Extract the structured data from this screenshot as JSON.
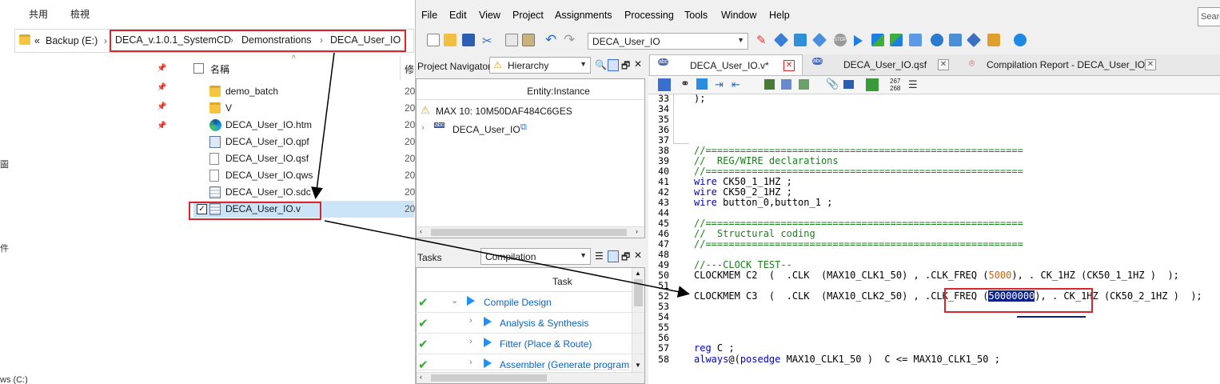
{
  "explorer": {
    "ribbon_tabs": [
      "共用",
      "檢視"
    ],
    "address": {
      "back_chevron": "«",
      "segments": [
        "Backup (E:)",
        "DECA_v.1.0.1_SystemCD",
        "Demonstrations",
        "DECA_User_IO"
      ]
    },
    "left_pane": {
      "partial_chars": [
        "圖",
        "件"
      ],
      "drive_partial": "ws (C:)"
    },
    "columns": {
      "name": "名稱",
      "modified_partial": "修"
    },
    "files": [
      {
        "name": "demo_batch",
        "type": "folder",
        "col2": "20"
      },
      {
        "name": "V",
        "type": "folder",
        "col2": "20"
      },
      {
        "name": "DECA_User_IO.htm",
        "type": "edge",
        "col2": "20"
      },
      {
        "name": "DECA_User_IO.qpf",
        "type": "qpf",
        "col2": "20"
      },
      {
        "name": "DECA_User_IO.qsf",
        "type": "doc",
        "col2": "20"
      },
      {
        "name": "DECA_User_IO.qws",
        "type": "doc",
        "col2": "20"
      },
      {
        "name": "DECA_User_IO.sdc",
        "type": "sdc",
        "col2": "20"
      },
      {
        "name": "DECA_User_IO.v",
        "type": "v",
        "col2": "20",
        "selected": true
      }
    ]
  },
  "quartus": {
    "menu": [
      "File",
      "Edit",
      "View",
      "Project",
      "Assignments",
      "Processing",
      "Tools",
      "Window",
      "Help"
    ],
    "search_placeholder": "Searc",
    "toolbar_combo": "DECA_User_IO",
    "project_navigator": {
      "title": "Project Navigator",
      "mode": "Hierarchy",
      "column": "Entity:Instance",
      "device": "MAX 10: 10M50DAF484C6GES",
      "top_entity": "DECA_User_IO",
      "abc_badge": "abc"
    },
    "tasks": {
      "title": "Tasks",
      "mode": "Compilation",
      "column": "Task",
      "items": [
        {
          "label": "Compile Design",
          "done": true,
          "level": 0
        },
        {
          "label": "Analysis & Synthesis",
          "done": true,
          "level": 1
        },
        {
          "label": "Fitter (Place & Route)",
          "done": true,
          "level": 1
        },
        {
          "label": "Assembler (Generate programm",
          "done": true,
          "level": 1
        }
      ]
    },
    "editor_tabs": [
      {
        "label": "DECA_User_IO.v*",
        "active": true
      },
      {
        "label": "DECA_User_IO.qsf",
        "active": false
      },
      {
        "label": "Compilation Report - DECA_User_IO",
        "active": false
      }
    ],
    "editor_toolbar_numbers": [
      "267",
      "268"
    ],
    "code_lines": [
      {
        "n": "33",
        "t": ");"
      },
      {
        "n": "34",
        "t": ""
      },
      {
        "n": "35",
        "t": ""
      },
      {
        "n": "36",
        "t": ""
      },
      {
        "n": "37",
        "t": ""
      },
      {
        "n": "38",
        "t": "//======================================================="
      },
      {
        "n": "39",
        "t": "//  REG/WIRE declarations"
      },
      {
        "n": "40",
        "t": "//======================================================="
      },
      {
        "n": "41",
        "t": "wire CK50_1_1HZ ;"
      },
      {
        "n": "42",
        "t": "wire CK50_2_1HZ ;"
      },
      {
        "n": "43",
        "t": "wire button_0,button_1 ;"
      },
      {
        "n": "44",
        "t": ""
      },
      {
        "n": "45",
        "t": "//======================================================="
      },
      {
        "n": "46",
        "t": "//  Structural coding"
      },
      {
        "n": "47",
        "t": "//======================================================="
      },
      {
        "n": "48",
        "t": ""
      },
      {
        "n": "49",
        "t": "//---CLOCK TEST--"
      },
      {
        "n": "50",
        "t": "CLOCKMEM C2  (  .CLK  (MAX10_CLK1_50) , .CLK_FREQ (5000), . CK_1HZ (CK50_1_1HZ )  );"
      },
      {
        "n": "51",
        "t": ""
      },
      {
        "n": "52",
        "t": "CLOCKMEM C3  (  .CLK  (MAX10_CLK2_50) , .CLK_FREQ (50000000), . CK_1HZ (CK50_2_1HZ )  );"
      },
      {
        "n": "53",
        "t": ""
      },
      {
        "n": "54",
        "t": ""
      },
      {
        "n": "55",
        "t": ""
      },
      {
        "n": "56",
        "t": ""
      },
      {
        "n": "57",
        "t": "reg C ;"
      },
      {
        "n": "58",
        "t": "always@(posedge MAX10_CLK1_50 )  C <= MAX10_CLK1_50 ;"
      }
    ],
    "highlight_value": "50000000",
    "freq_value_c2": "5000"
  },
  "colors": {
    "annotation_red": "#d9262c",
    "selection": "#0a1e8c",
    "keyword": "#0000c8",
    "comment": "#1d7f1d",
    "number": "#e06000",
    "check": "#2fae2f"
  }
}
